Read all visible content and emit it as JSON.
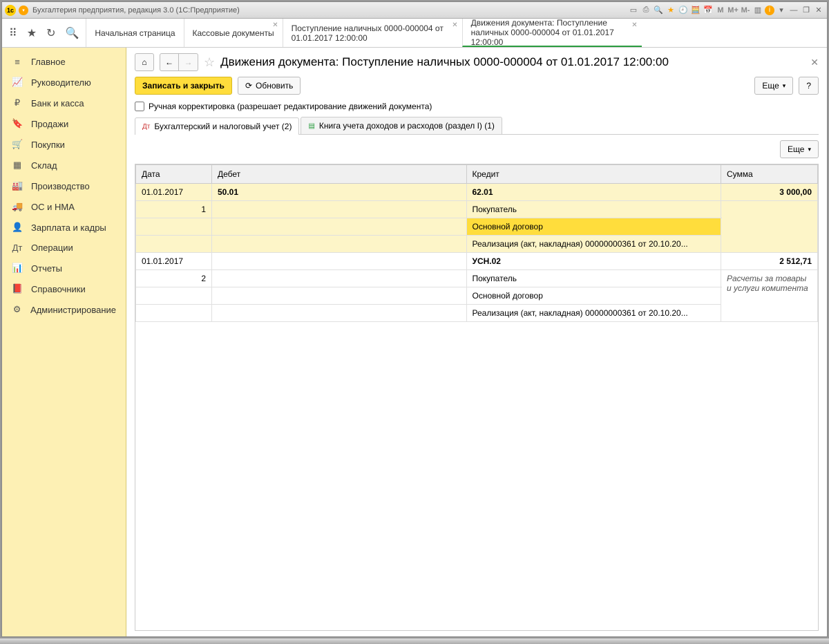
{
  "window": {
    "title": "Бухгалтерия предприятия, редакция 3.0  (1С:Предприятие)"
  },
  "tabs": [
    {
      "label": "Начальная страница",
      "closable": false
    },
    {
      "label": "Кассовые документы",
      "closable": true
    },
    {
      "label": "Поступление наличных 0000-000004 от 01.01.2017 12:00:00",
      "closable": true
    },
    {
      "label": "Движения документа: Поступление наличных 0000-000004 от 01.01.2017 12:00:00",
      "closable": true,
      "active": true
    }
  ],
  "sidebar": {
    "items": [
      {
        "icon": "≡",
        "label": "Главное"
      },
      {
        "icon": "📈",
        "label": "Руководителю"
      },
      {
        "icon": "₽",
        "label": "Банк и касса"
      },
      {
        "icon": "🔖",
        "label": "Продажи"
      },
      {
        "icon": "🛒",
        "label": "Покупки"
      },
      {
        "icon": "▦",
        "label": "Склад"
      },
      {
        "icon": "🏭",
        "label": "Производство"
      },
      {
        "icon": "🚚",
        "label": "ОС и НМА"
      },
      {
        "icon": "👤",
        "label": "Зарплата и кадры"
      },
      {
        "icon": "Дт",
        "label": "Операции"
      },
      {
        "icon": "📊",
        "label": "Отчеты"
      },
      {
        "icon": "📕",
        "label": "Справочники"
      },
      {
        "icon": "⚙",
        "label": "Администрирование"
      }
    ]
  },
  "page": {
    "title": "Движения документа: Поступление наличных 0000-000004 от 01.01.2017 12:00:00",
    "save_close": "Записать и закрыть",
    "refresh": "Обновить",
    "more": "Еще",
    "help": "?",
    "manual_edit": "Ручная корректировка (разрешает редактирование движений документа)"
  },
  "inner_tabs": [
    {
      "label": "Бухгалтерский и налоговый учет (2)",
      "active": true
    },
    {
      "label": "Книга учета доходов и расходов (раздел I) (1)",
      "active": false
    }
  ],
  "table": {
    "headers": {
      "date": "Дата",
      "debit": "Дебет",
      "credit": "Кредит",
      "sum": "Сумма"
    },
    "more": "Еще",
    "rows": [
      {
        "highlight": true,
        "date": "01.01.2017",
        "n": "1",
        "debit": "50.01",
        "credit": "62.01",
        "credit_sub": [
          "Покупатель",
          "Основной договор",
          "Реализация (акт, накладная) 00000000361 от 20.10.20..."
        ],
        "selected_credit_sub": 1,
        "sum": "3 000,00",
        "note": ""
      },
      {
        "highlight": false,
        "date": "01.01.2017",
        "n": "2",
        "debit": "",
        "credit": "УСН.02",
        "credit_sub": [
          "Покупатель",
          "Основной договор",
          "Реализация (акт, накладная) 00000000361 от 20.10.20..."
        ],
        "selected_credit_sub": -1,
        "sum": "2 512,71",
        "note": "Расчеты за товары и услуги комитента"
      }
    ]
  }
}
